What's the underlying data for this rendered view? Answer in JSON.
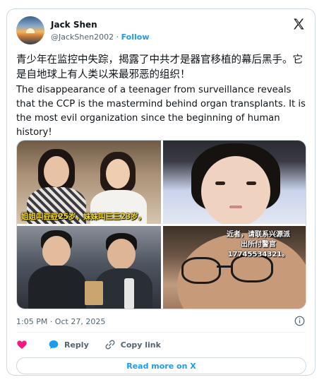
{
  "tweet": {
    "author_name": "Jack Shen",
    "handle": "@JackShen2002",
    "separator": " · ",
    "follow_label": "Follow",
    "text_zh": "青少年在监控中失踪，揭露了中共才是器官移植的幕后黑手。它是自地球上有人类以来最邪恶的组织！",
    "text_en": "The disappearance of a teenager from surveillance reveals that the CCP is the mastermind behind organ transplants. It is the most evil organization since the beginning of human history!",
    "timestamp": "1:05 PM · Oct 27, 2025"
  },
  "media": {
    "caption_tile1": "姐姐叫豆豆25岁，妹妹叫三三23岁，",
    "tile4_line1": "近者，请联系兴源派",
    "tile4_line2": "出所付警官",
    "tile4_line3": "17745534321。"
  },
  "actions": {
    "reply_label": "Reply",
    "copy_link_label": "Copy link"
  },
  "footer": {
    "read_more_label": "Read more on X"
  },
  "colors": {
    "accent": "#1d9bf0",
    "heart": "#f91880",
    "muted": "#536471",
    "border": "#cfd9de"
  },
  "icons": [
    "x-logo-icon",
    "info-icon",
    "heart-icon",
    "reply-bubble-icon",
    "link-icon"
  ]
}
